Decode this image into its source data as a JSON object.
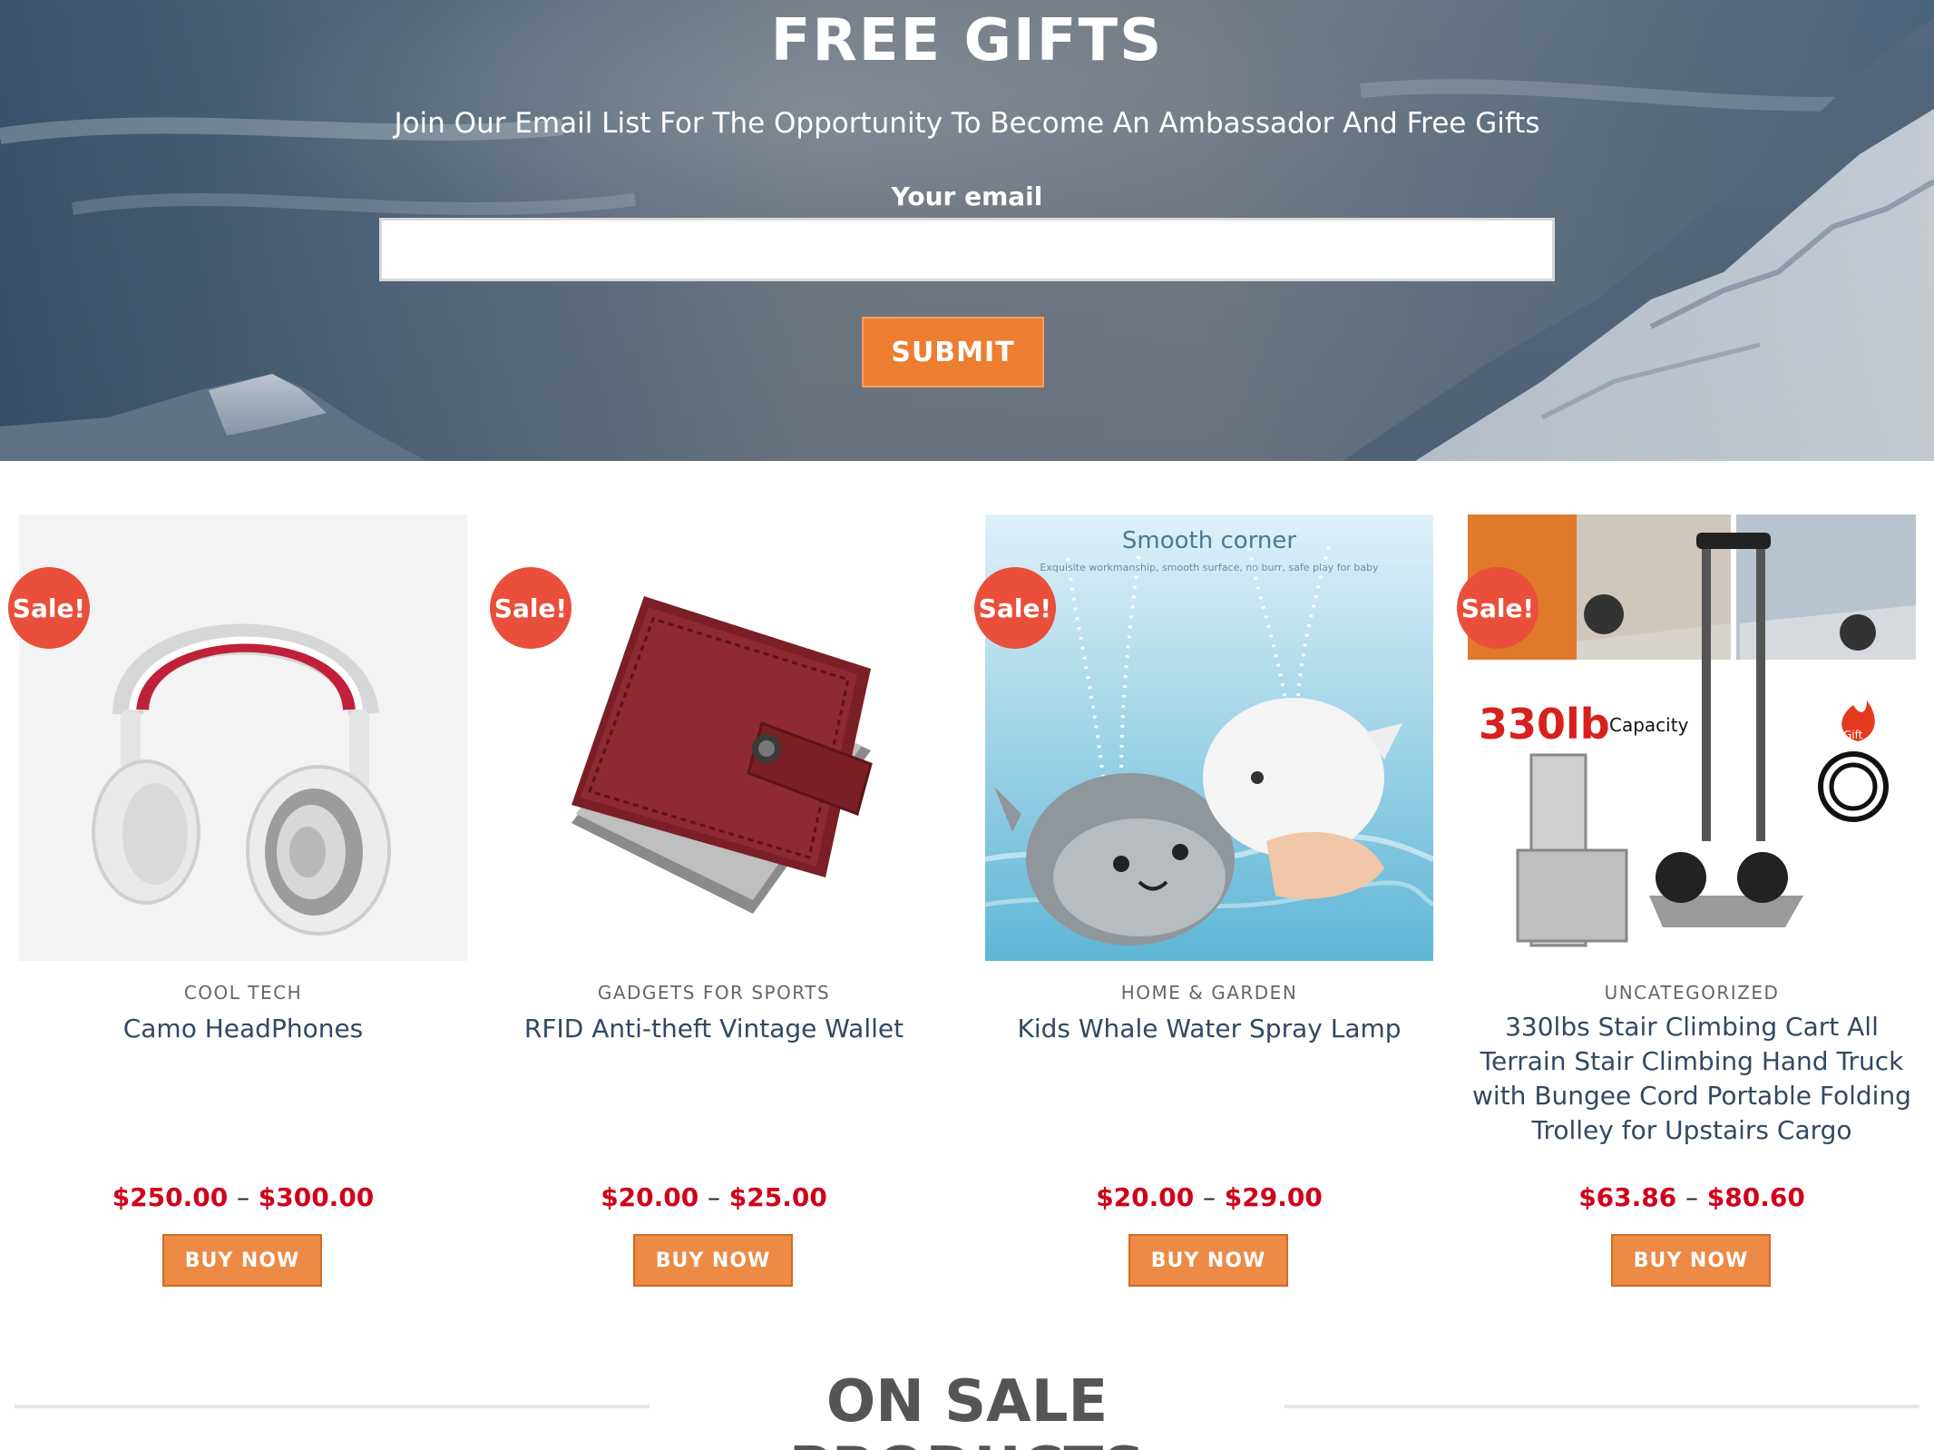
{
  "hero": {
    "title": "FREE GIFTS",
    "subtitle": "Join Our Email List For The Opportunity To Become An Ambassador And Free Gifts",
    "email_label": "Your email",
    "email_value": "",
    "submit_label": "SUBMIT"
  },
  "products": [
    {
      "badge": "Sale!",
      "category": "COOL TECH",
      "name": "Camo HeadPhones",
      "price_low": "$250.00",
      "price_sep": "–",
      "price_high": "$300.00",
      "button": "BUY NOW",
      "image_icon": "headphones-image"
    },
    {
      "badge": "Sale!",
      "category": "GADGETS FOR SPORTS",
      "name": "RFID Anti-theft Vintage Wallet",
      "price_low": "$20.00",
      "price_sep": "–",
      "price_high": "$25.00",
      "button": "BUY NOW",
      "image_icon": "wallet-image"
    },
    {
      "badge": "Sale!",
      "category": "HOME & GARDEN",
      "name": "Kids Whale Water Spray Lamp",
      "price_low": "$20.00",
      "price_sep": "–",
      "price_high": "$29.00",
      "button": "BUY NOW",
      "image_icon": "whale-lamp-image",
      "image_caption": "Smooth corner",
      "image_subcaption": "Exquisite workmanship, smooth surface, no burr, safe play for baby"
    },
    {
      "badge": "Sale!",
      "category": "UNCATEGORIZED",
      "name": "330lbs Stair Climbing Cart All Terrain Stair Climbing Hand Truck with Bungee Cord Portable Folding Trolley for Upstairs Cargo",
      "price_low": "$63.86",
      "price_sep": "–",
      "price_high": "$80.60",
      "button": "BUY NOW",
      "image_icon": "hand-truck-image",
      "image_capacity": "330lb",
      "image_capacity_label": "Capacity",
      "image_gift": "Gift"
    }
  ],
  "section": {
    "title": "ON SALE PRODUCTS"
  },
  "colors": {
    "accent": "#ed7d31",
    "sale_badge": "#e94f3a",
    "price": "#d0021b",
    "link": "#334862"
  }
}
